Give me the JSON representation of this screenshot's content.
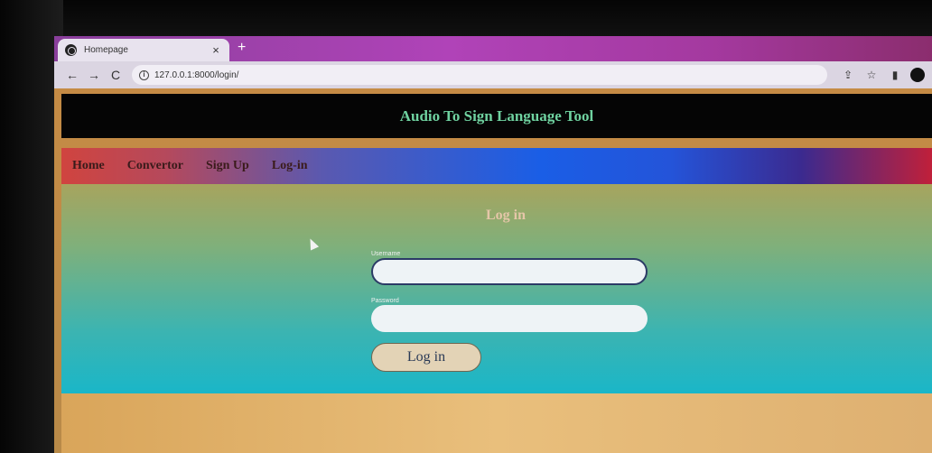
{
  "browser": {
    "tab_title": "Homepage",
    "tab_close": "×",
    "new_tab": "+",
    "url": "127.0.0.1:8000/login/",
    "back": "←",
    "forward": "→",
    "reload": "C"
  },
  "header": {
    "title": "Audio To Sign Language Tool"
  },
  "navbar": {
    "items": [
      {
        "label": "Home"
      },
      {
        "label": "Convertor"
      },
      {
        "label": "Sign Up"
      },
      {
        "label": "Log-in"
      }
    ]
  },
  "login": {
    "heading": "Log in",
    "username_label": "Username",
    "password_label": "Password",
    "submit_label": "Log in"
  },
  "colors": {
    "header_text": "#6fd2a0",
    "tab_bar": "#b043b8"
  }
}
